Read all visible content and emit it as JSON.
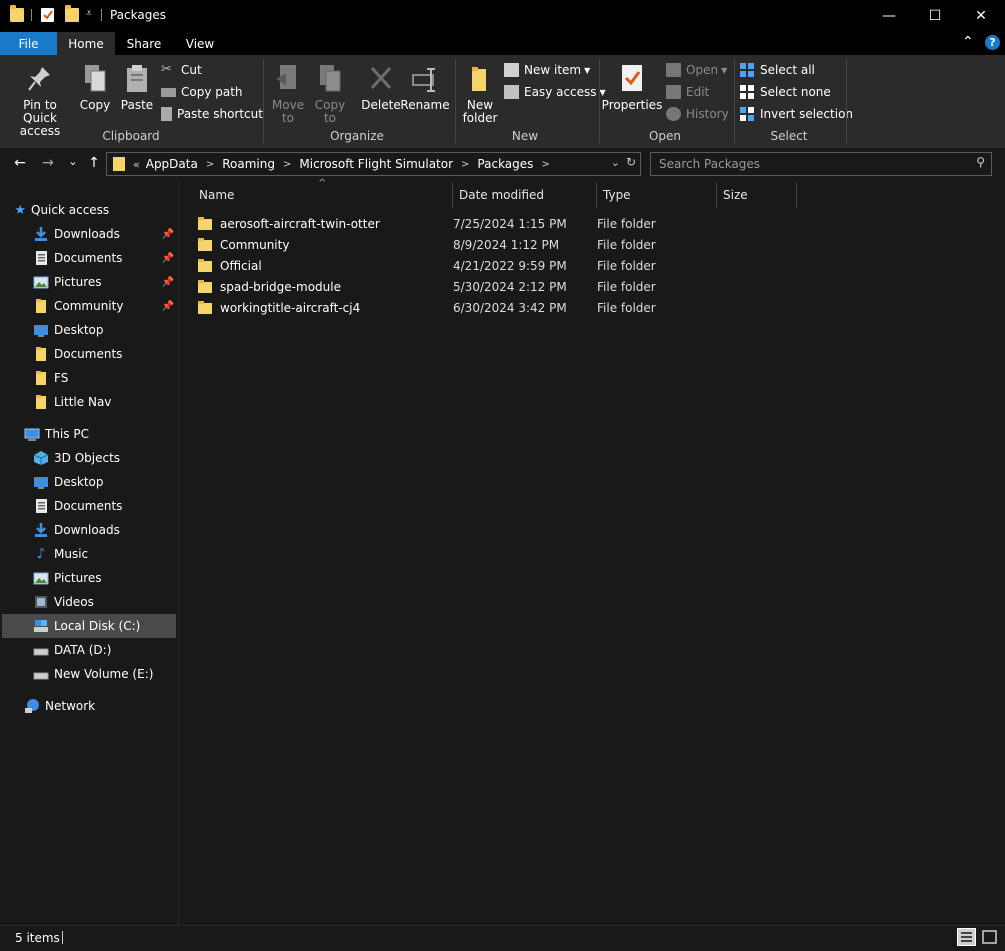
{
  "window": {
    "title": "Packages",
    "minimize_glyph": "—",
    "maximize_glyph": "☐",
    "close_glyph": "✕"
  },
  "menu": {
    "tabs": [
      {
        "label": "File"
      },
      {
        "label": "Home"
      },
      {
        "label": "Share"
      },
      {
        "label": "View"
      }
    ],
    "collapse_glyph": "⌃",
    "help_glyph": "?"
  },
  "ribbon": {
    "clipboard": {
      "pin_label": "Pin to Quick access",
      "copy_label": "Copy",
      "paste_label": "Paste",
      "cut_label": "Cut",
      "copy_path_label": "Copy path",
      "paste_shortcut_label": "Paste shortcut",
      "group_label": "Clipboard"
    },
    "organize": {
      "move_to_label": "Move to",
      "copy_to_label": "Copy to",
      "delete_label": "Delete",
      "rename_label": "Rename",
      "group_label": "Organize"
    },
    "new": {
      "new_folder_label": "New folder",
      "new_item_label": "New item",
      "easy_access_label": "Easy access",
      "group_label": "New"
    },
    "open": {
      "properties_label": "Properties",
      "open_label": "Open",
      "edit_label": "Edit",
      "history_label": "History",
      "group_label": "Open"
    },
    "select": {
      "select_all_label": "Select all",
      "select_none_label": "Select none",
      "invert_label": "Invert selection",
      "group_label": "Select"
    }
  },
  "navigation": {
    "back_glyph": "←",
    "forward_glyph": "→",
    "recent_glyph": "⌄",
    "up_glyph": "↑",
    "breadcrumb_overflow": "«",
    "breadcrumbs": [
      "AppData",
      "Roaming",
      "Microsoft Flight Simulator",
      "Packages"
    ],
    "search_placeholder": "Search Packages"
  },
  "sidebar": {
    "quick_access_label": "Quick access",
    "quick_access_items": [
      {
        "label": "Downloads",
        "pinned": true,
        "icon": "downloads-icon"
      },
      {
        "label": "Documents",
        "pinned": true,
        "icon": "documents-icon"
      },
      {
        "label": "Pictures",
        "pinned": true,
        "icon": "pictures-icon"
      },
      {
        "label": "Community",
        "pinned": true,
        "icon": "folder-icon"
      },
      {
        "label": "Desktop",
        "pinned": false,
        "icon": "desktop-icon"
      },
      {
        "label": "Documents",
        "pinned": false,
        "icon": "folder-icon"
      },
      {
        "label": "FS",
        "pinned": false,
        "icon": "folder-icon"
      },
      {
        "label": "Little Nav",
        "pinned": false,
        "icon": "folder-icon"
      }
    ],
    "this_pc_label": "This PC",
    "this_pc_items": [
      {
        "label": "3D Objects",
        "icon": "3d-objects-icon"
      },
      {
        "label": "Desktop",
        "icon": "desktop-icon"
      },
      {
        "label": "Documents",
        "icon": "documents-icon"
      },
      {
        "label": "Downloads",
        "icon": "downloads-icon"
      },
      {
        "label": "Music",
        "icon": "music-icon"
      },
      {
        "label": "Pictures",
        "icon": "pictures-icon"
      },
      {
        "label": "Videos",
        "icon": "videos-icon"
      },
      {
        "label": "Local Disk (C:)",
        "icon": "local-disk-icon",
        "selected": true
      },
      {
        "label": "DATA (D:)",
        "icon": "drive-icon"
      },
      {
        "label": "New Volume (E:)",
        "icon": "drive-icon"
      }
    ],
    "network_label": "Network"
  },
  "file_list": {
    "columns": [
      "Name",
      "Date modified",
      "Type",
      "Size"
    ],
    "sort_glyph": "^",
    "rows": [
      {
        "name": "aerosoft-aircraft-twin-otter",
        "date": "7/25/2024 1:15 PM",
        "type": "File folder"
      },
      {
        "name": "Community",
        "date": "8/9/2024 1:12 PM",
        "type": "File folder"
      },
      {
        "name": "Official",
        "date": "4/21/2022 9:59 PM",
        "type": "File folder"
      },
      {
        "name": "spad-bridge-module",
        "date": "5/30/2024 2:12 PM",
        "type": "File folder"
      },
      {
        "name": "workingtitle-aircraft-cj4",
        "date": "6/30/2024 3:42 PM",
        "type": "File folder"
      }
    ]
  },
  "status": {
    "item_count": "5 items"
  },
  "colors": {
    "accent": "#1979ca",
    "folder": "#f5d46b",
    "background": "#191919",
    "ribbon": "#2b2b2b"
  }
}
